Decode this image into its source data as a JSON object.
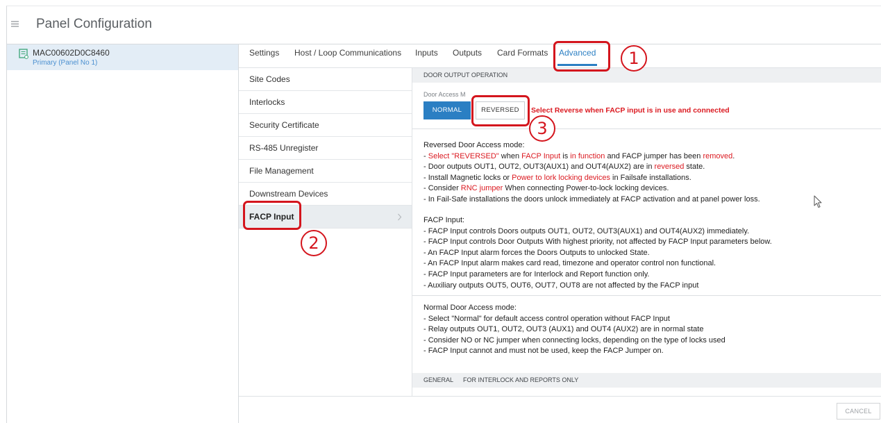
{
  "header": {
    "title": "Panel Configuration",
    "menu_icon": "hamburger-menu-icon"
  },
  "panel_list": [
    {
      "name": "MAC00602D0C8460",
      "subtitle": "Primary (Panel No 1)",
      "icon": "panel-icon",
      "selected": true
    }
  ],
  "tabs": [
    {
      "label": "Settings"
    },
    {
      "label": "Host / Loop Communications"
    },
    {
      "label": "Inputs"
    },
    {
      "label": "Outputs"
    },
    {
      "label": "Card Formats"
    },
    {
      "label": "Advanced",
      "active": true
    }
  ],
  "subnav": [
    {
      "label": "Site Codes"
    },
    {
      "label": "Interlocks"
    },
    {
      "label": "Security Certificate"
    },
    {
      "label": "RS-485 Unregister"
    },
    {
      "label": "File Management"
    },
    {
      "label": "Downstream Devices"
    },
    {
      "label": "FACP Input",
      "selected": true,
      "icon": "chevron-right-icon"
    }
  ],
  "door_output": {
    "section_title": "DOOR OUTPUT OPERATION",
    "mode_label": "Door Access M",
    "options": [
      {
        "label": "NORMAL",
        "selected": true
      },
      {
        "label": "REVERSED",
        "selected": false
      }
    ],
    "hint": "Select Reverse when FACP input is in use and connected"
  },
  "info_blocks": [
    {
      "heading": "Reversed Door Access mode:",
      "lines": [
        [
          {
            "text": "- "
          },
          {
            "text": "Select \"REVERSED\"",
            "emphasis": true
          },
          {
            "text": " when "
          },
          {
            "text": "FACP Input",
            "emphasis": true
          },
          {
            "text": " is "
          },
          {
            "text": "in function",
            "emphasis": true
          },
          {
            "text": " and FACP jumper has been "
          },
          {
            "text": "removed",
            "emphasis": true
          },
          {
            "text": "."
          }
        ],
        [
          {
            "text": "- Door outputs OUT1, OUT2, OUT3(AUX1) and OUT4(AUX2) are in "
          },
          {
            "text": "reversed",
            "emphasis": true
          },
          {
            "text": " state."
          }
        ],
        [
          {
            "text": "- Install Magnetic locks or "
          },
          {
            "text": "Power to lork locking devices",
            "emphasis": true
          },
          {
            "text": " in Failsafe installations."
          }
        ],
        [
          {
            "text": "- Consider "
          },
          {
            "text": "RNC jumper",
            "emphasis": true
          },
          {
            "text": " When connecting Power-to-lock locking devices."
          }
        ],
        [
          {
            "text": "- In Fail-Safe installations the doors unlock immediately at FACP activation and at panel power loss."
          }
        ]
      ]
    },
    {
      "heading": "FACP Input:",
      "lines": [
        [
          {
            "text": "- FACP Input controls Doors outputs OUT1, OUT2, OUT3(AUX1) and OUT4(AUX2) immediately."
          }
        ],
        [
          {
            "text": "- FACP Input controls Door Outputs With highest priority, not affected by FACP Input parameters below."
          }
        ],
        [
          {
            "text": "- An FACP Input alarm forces the Doors Outputs to unlocked State."
          }
        ],
        [
          {
            "text": "- An FACP Input alarm makes card read, timezone and operator control non functional."
          }
        ],
        [
          {
            "text": "- FACP Input parameters are for Interlock and Report function only."
          }
        ],
        [
          {
            "text": "- Auxiliary outputs OUT5, OUT6, OUT7, OUT8 are not affected by the FACP input"
          }
        ]
      ]
    },
    {
      "heading": "Normal Door Access mode:",
      "lines": [
        [
          {
            "text": "- Select \"Normal\" for default access control operation without FACP Input"
          }
        ],
        [
          {
            "text": "- Relay outputs OUT1, OUT2, OUT3 (AUX1) and OUT4 (AUX2) are in normal state"
          }
        ],
        [
          {
            "text": "- Consider NO or NC jumper when connecting locks, depending on the type of locks used"
          }
        ],
        [
          {
            "text": "- FACP Input cannot and must not be used, keep the FACP Jumper on."
          }
        ]
      ]
    }
  ],
  "general_section": {
    "title": "GENERAL",
    "subtitle": "FOR INTERLOCK AND REPORTS ONLY"
  },
  "footer": {
    "cancel_label": "CANCEL"
  },
  "annotations": {
    "circle_labels": [
      "1",
      "2",
      "3"
    ]
  },
  "cursor_icon": "mouse-pointer-icon",
  "colors": {
    "accent": "#2b7fc3",
    "annotation_red": "#d4151d",
    "emphasis_red": "#db1a21",
    "selected_panel_bg": "#e3edf6",
    "panel_role_text": "#4a8fd0"
  }
}
